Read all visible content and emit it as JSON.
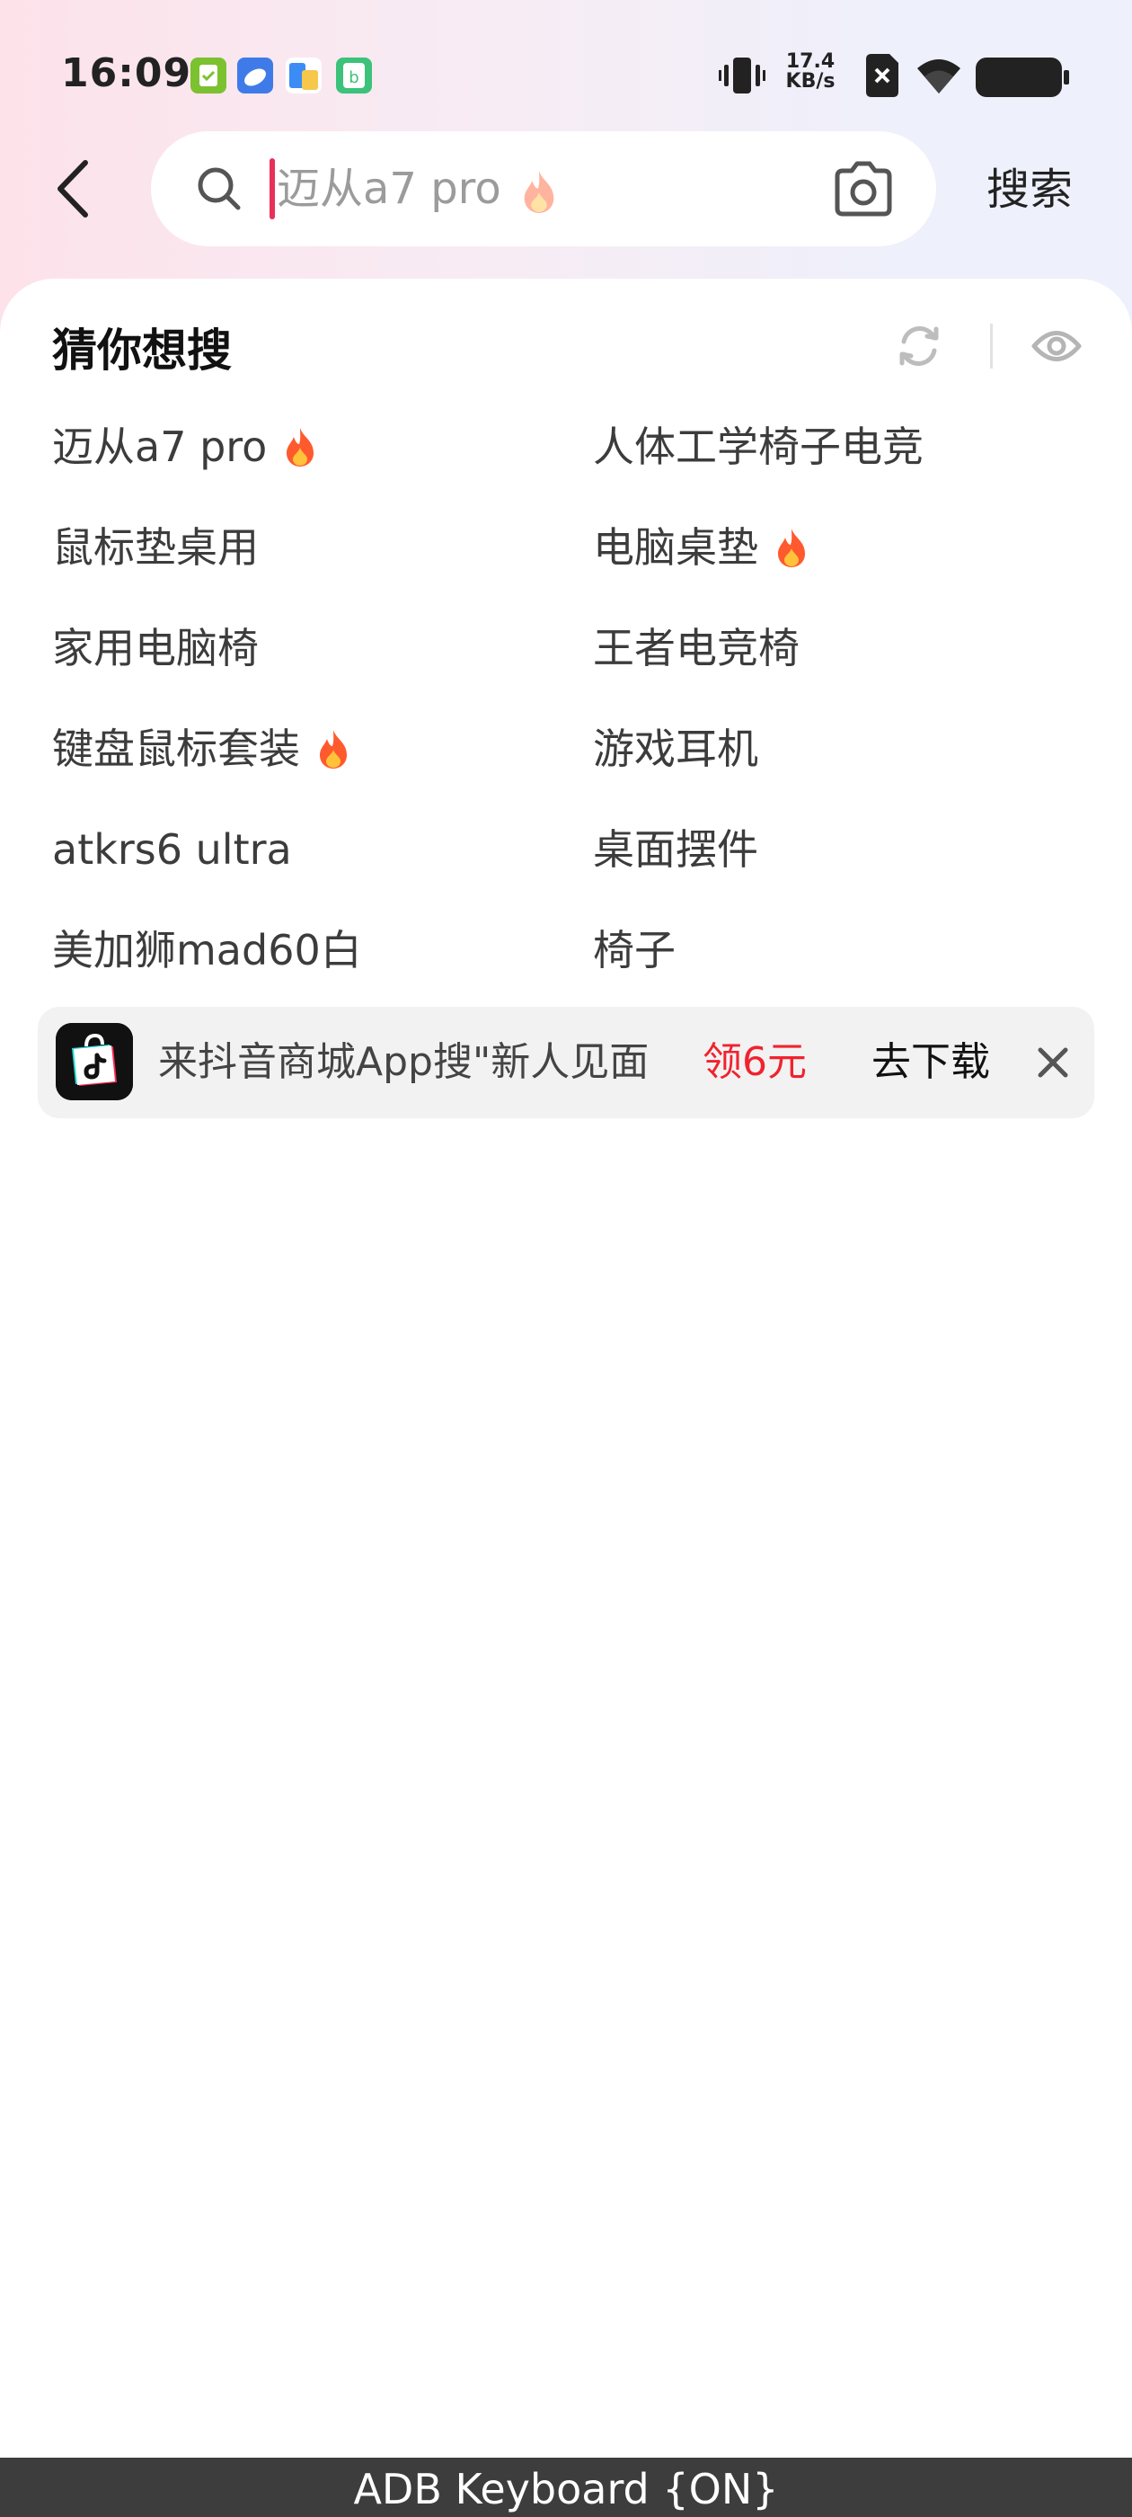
{
  "status_bar": {
    "time": "16:09",
    "app_icons": [
      "clipboard-check-icon",
      "cloud-app-icon",
      "file-app-icon",
      "wechat-mini-app-icon"
    ],
    "net_speed_value": "17.4",
    "net_speed_unit": "KB/s",
    "icons": [
      "vibrate-icon",
      "no-sim-icon",
      "wifi-icon",
      "battery-icon"
    ]
  },
  "search": {
    "back_icon": "chevron-left-icon",
    "placeholder": "迈从a7 pro",
    "value": "",
    "camera_icon": "camera-icon",
    "button_label": "搜索"
  },
  "guess": {
    "title": "猜你想搜",
    "refresh_icon": "refresh-icon",
    "visibility_icon": "eye-icon",
    "items": [
      {
        "label": "迈从a7 pro",
        "hot": true
      },
      {
        "label": "人体工学椅子电竞",
        "hot": false
      },
      {
        "label": "鼠标垫桌用",
        "hot": false
      },
      {
        "label": "电脑桌垫",
        "hot": true
      },
      {
        "label": "家用电脑椅",
        "hot": false
      },
      {
        "label": "王者电竞椅",
        "hot": false
      },
      {
        "label": "键盘鼠标套装",
        "hot": true
      },
      {
        "label": "游戏耳机",
        "hot": false
      },
      {
        "label": "atkrs6 ultra",
        "hot": false
      },
      {
        "label": "桌面摆件",
        "hot": false
      },
      {
        "label": "美加狮mad60白",
        "hot": false
      },
      {
        "label": "椅子",
        "hot": false
      }
    ]
  },
  "promo": {
    "text": "来抖音商城App搜\"新人见面",
    "reward": "领6元",
    "download_label": "去下载",
    "close_icon": "close-icon",
    "reward_color": "#f0232e"
  },
  "keyboard_bar": {
    "label": "ADB Keyboard {ON}"
  }
}
